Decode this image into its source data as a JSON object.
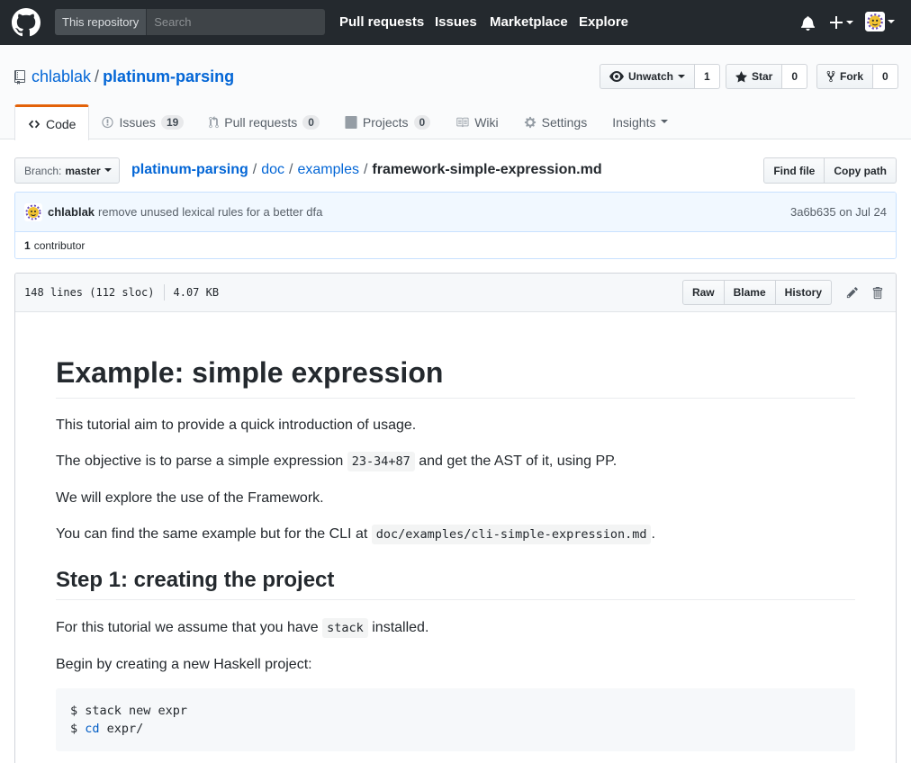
{
  "header": {
    "scope_label": "This repository",
    "search_placeholder": "Search",
    "nav": [
      "Pull requests",
      "Issues",
      "Marketplace",
      "Explore"
    ],
    "icons": [
      "github-logo-icon",
      "bell-icon",
      "plus-icon",
      "avatar"
    ]
  },
  "repo": {
    "owner": "chlablak",
    "separator": "/",
    "name": "platinum-parsing",
    "unwatch_label": "Unwatch",
    "watch_count": "1",
    "star_label": "Star",
    "star_count": "0",
    "fork_label": "Fork",
    "fork_count": "0"
  },
  "tabs": [
    {
      "label": "Code",
      "counter": null,
      "icon": "code-icon"
    },
    {
      "label": "Issues",
      "counter": "19",
      "icon": "issue-icon"
    },
    {
      "label": "Pull requests",
      "counter": "0",
      "icon": "pull-request-icon"
    },
    {
      "label": "Projects",
      "counter": "0",
      "icon": "project-icon"
    },
    {
      "label": "Wiki",
      "counter": null,
      "icon": "book-icon"
    },
    {
      "label": "Settings",
      "counter": null,
      "icon": "gear-icon"
    },
    {
      "label": "Insights",
      "counter": null,
      "icon": "caret-down-icon"
    }
  ],
  "file_nav": {
    "branch_label": "Branch:",
    "branch_value": "master",
    "breadcrumb": [
      "platinum-parsing",
      "doc",
      "examples"
    ],
    "filename": "framework-simple-expression.md",
    "find_file": "Find file",
    "copy_path": "Copy path"
  },
  "commit": {
    "author": "chlablak",
    "message": "remove unused lexical rules for a better dfa",
    "sha": "3a6b635",
    "date": "on Jul 24",
    "contributor_count": "1",
    "contributor_label": "contributor"
  },
  "file": {
    "lines": "148 lines (112 sloc)",
    "size": "4.07 KB",
    "raw": "Raw",
    "blame": "Blame",
    "history": "History"
  },
  "markdown": {
    "h1": "Example: simple expression",
    "p1": "This tutorial aim to provide a quick introduction of usage.",
    "p2_before": "The objective is to parse a simple expression",
    "p2_code": "23-34+87",
    "p2_after": "and get the AST of it, using PP.",
    "p3": "We will explore the use of the Framework.",
    "p4_before": "You can find the same example but for the CLI at",
    "p4_code": "doc/examples/cli-simple-expression.md",
    "p4_after": ".",
    "h2": "Step 1: creating the project",
    "p5_before": "For this tutorial we assume that you have",
    "p5_code": "stack",
    "p5_after": "installed.",
    "p6": "Begin by creating a new Haskell project:",
    "code_line1": "$ stack new expr",
    "code_line2_prefix": "$ ",
    "code_line2_kw": "cd",
    "code_line2_rest": " expr/"
  },
  "colors": {
    "header_bg": "#24292e",
    "link": "#0366d6",
    "tab_accent": "#e36209"
  }
}
